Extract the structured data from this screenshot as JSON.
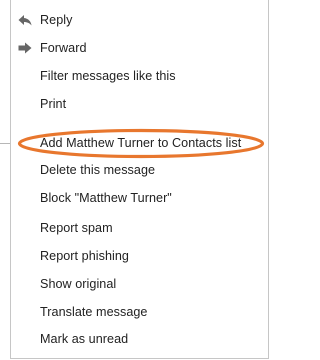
{
  "menu": {
    "items": [
      {
        "label": "Reply",
        "icon": "reply-icon"
      },
      {
        "label": "Forward",
        "icon": "forward-icon"
      },
      {
        "label": "Filter messages like this"
      },
      {
        "label": "Print"
      },
      {
        "label": "Add Matthew Turner to Contacts list"
      },
      {
        "label": "Delete this message"
      },
      {
        "label": "Block \"Matthew Turner\""
      },
      {
        "label": "Report spam"
      },
      {
        "label": "Report phishing"
      },
      {
        "label": "Show original"
      },
      {
        "label": "Translate message"
      },
      {
        "label": "Mark as unread"
      }
    ]
  },
  "colors": {
    "highlight_ellipse": "#e8772e",
    "icon_gray": "#666666",
    "text": "#222222"
  }
}
